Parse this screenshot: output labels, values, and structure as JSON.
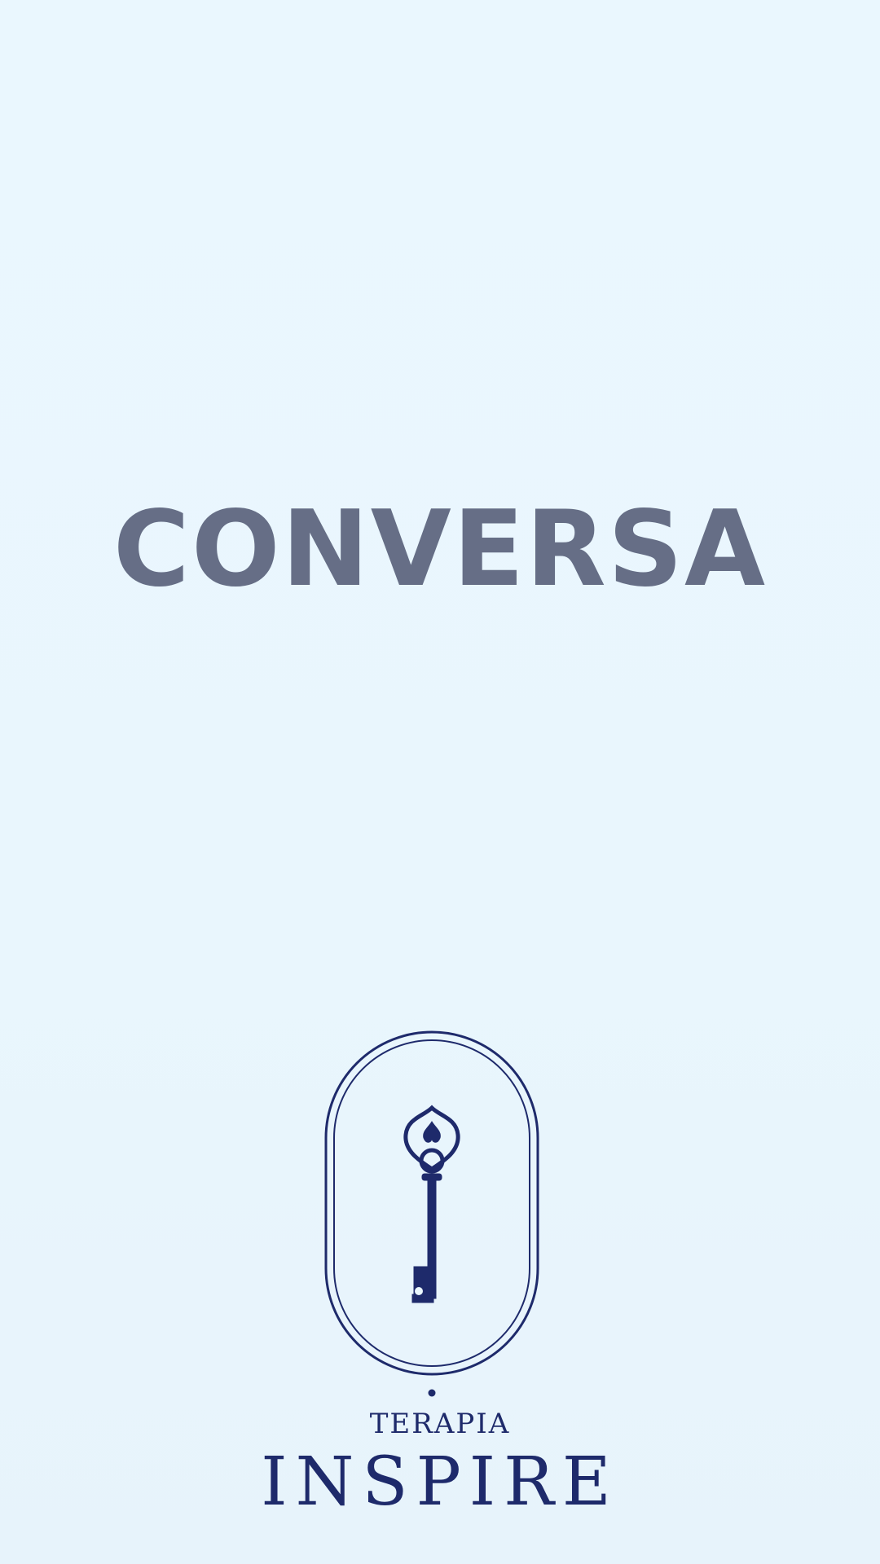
{
  "screen": {
    "title": "CONVERSA",
    "background_color": "#eaf7fe",
    "title_color": "#666e86"
  },
  "brand": {
    "logo_icon": "key-icon",
    "subtitle": "TERAPIA",
    "name": "INSPIRE",
    "color": "#1e2a6b"
  }
}
